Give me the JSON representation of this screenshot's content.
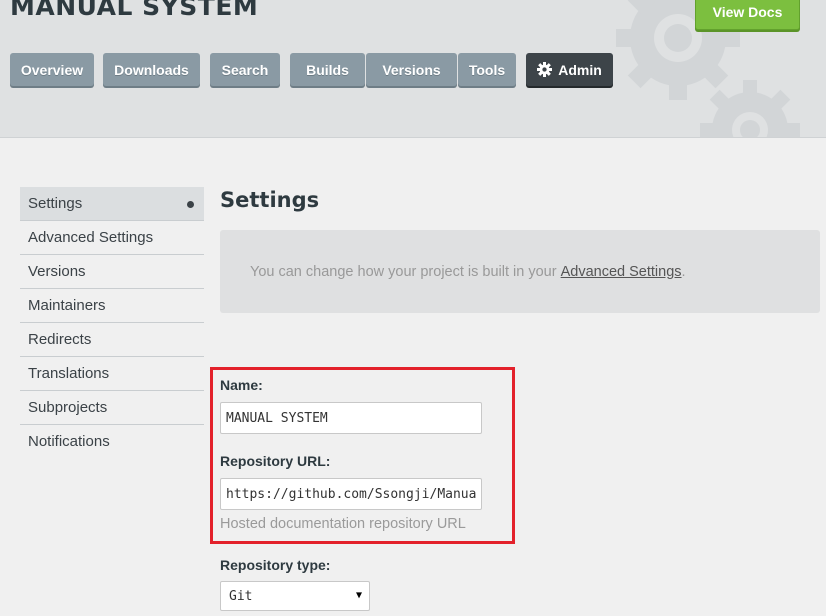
{
  "header": {
    "project_title": "MANUAL SYSTEM",
    "view_docs_label": "View Docs",
    "tabs": [
      {
        "label": "Overview"
      },
      {
        "label": "Downloads"
      },
      {
        "label": "Search"
      },
      {
        "label": "Builds"
      },
      {
        "label": "Versions"
      },
      {
        "label": "Tools"
      },
      {
        "label": "Admin",
        "icon": "gear-icon"
      }
    ]
  },
  "sidebar": {
    "items": [
      {
        "label": "Settings",
        "active": true
      },
      {
        "label": "Advanced Settings"
      },
      {
        "label": "Versions"
      },
      {
        "label": "Maintainers"
      },
      {
        "label": "Redirects"
      },
      {
        "label": "Translations"
      },
      {
        "label": "Subprojects"
      },
      {
        "label": "Notifications"
      }
    ]
  },
  "main": {
    "title": "Settings",
    "info_text": "You can change how your project is built in your",
    "info_link": "Advanced Settings",
    "info_suffix": ".",
    "form": {
      "name_label": "Name:",
      "name_value": "MANUAL SYSTEM",
      "repo_url_label": "Repository URL:",
      "repo_url_value": "https://github.com/Ssongji/Manual-System",
      "repo_url_help": "Hosted documentation repository URL",
      "repo_type_label": "Repository type:",
      "repo_type_value": "Git"
    }
  },
  "colors": {
    "highlight": "#e3212b",
    "view_docs": "#7cbf3f",
    "tab": "#8a9aa4",
    "admin_tab": "#3d4449"
  }
}
